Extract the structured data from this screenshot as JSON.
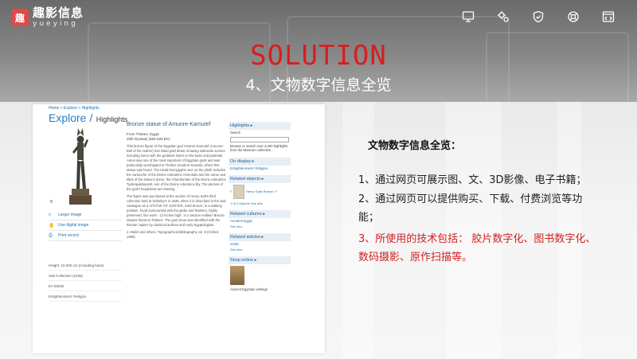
{
  "brand": {
    "name_cn": "趣影信息",
    "name_en": "yueying",
    "mark": "趣"
  },
  "toolbar": {
    "icons": [
      "monitor-icon",
      "gear-network-icon",
      "shield-check-icon",
      "support-icon",
      "code-window-icon"
    ]
  },
  "slide": {
    "title": "SOLUTION",
    "subtitle": "4、文物数字信息全览"
  },
  "web": {
    "breadcrumb": "Home > Explore > Highlights",
    "explore": "Explore /",
    "highlights": "Highlights",
    "b_mark": "B",
    "links": [
      {
        "icon": "search-icon",
        "label": "Larger image"
      },
      {
        "icon": "hand-icon",
        "label": "Use digital image"
      },
      {
        "icon": "print-icon",
        "label": "Print record"
      }
    ],
    "meta": [
      "Height: 22.000 cm (including base)",
      "Salt Collection (1835)",
      "EA 60042",
      "Enlightenment: Religion"
    ],
    "article": {
      "title": "Bronze statue of Amunre-Kamutef",
      "origin": "From Thebes, Egypt",
      "dynasty": "20th Dynasty (664-525 BC)",
      "p1": "This bronze figure of the Egyptian god Amunre-Kamutef (Amunre-Bull of his mother) has inlaid gold detail, showing elaborate scenes including some with the goddess Neret on the base and pedestal. Amun was one of the most important of Egyptian gods and was particularly worshipped at Thebes (modern Karnak), where this statue was found. The inlaid hieroglyphic text on the plinth includes the cartouche of the Divine Adoratrice Amenirdis and the name and titles of the statue's donor, the Chamberlain of the Divine Adoratrice Tjeborpakhepesh, son of the Divine Adoratrice lby. The plumes of the god's headdress are missing.",
      "p2": "The figure was purchased at the auction of Henry Salt's third collection held at Sotheby's in 1835, when it is described in the sale catalogue as a 'STATUE OF JUPITER, solid bronze, in a walking position, head surmounted with the globe and feathers, highly preserved, fine work - 12 inches high'. In a section entitled 'Bronze statues found at Thebes'. The god Amun was identified with the Roman Jupiter by classical authors and early Egyptologists.",
      "ref": "J. Malek and others, Topographical bibliography vol. 8 (Oxford, 1999)"
    },
    "side": {
      "highlights": "Highlights ▸",
      "search_label": "Search",
      "browse_text": "Browse or search over 4,000 highlights from the Museum collection",
      "on_display": "On display ▸",
      "on_display_link": "Enlightenment: Religion",
      "related_objects": "Related objects ▸",
      "related_thumb_label": "Henry Salts Roman",
      "pager": "1 of 2 Objects",
      "see_all": "See all ▸",
      "related_cultures": "Related cultures ▸",
      "culture_link": "Ancient Egypt",
      "see_all_2": "See all ▸",
      "related_articles": "Related articles ▸",
      "article_link": "Gods",
      "see_all_3": "See all ▸",
      "shop": "Shop online ▸",
      "shop_label": "Ancient Egyptian writings"
    }
  },
  "panel": {
    "heading": "文物数字信息全览：",
    "line1": "1、通过网页可展示图、文、3D影像、电子书籍；",
    "line2a": "2、通过网页可以提供购买、下载、付费浏览等功",
    "line2b": "能；",
    "line3a": "3、所使用的技术包括： 胶片数字化、图书数字化、",
    "line3b": "数码摄影、原作扫描等。"
  },
  "colors": {
    "title_red": "#d81e1e",
    "accent_red": "#d12222",
    "link_blue": "#1a6fb0"
  }
}
